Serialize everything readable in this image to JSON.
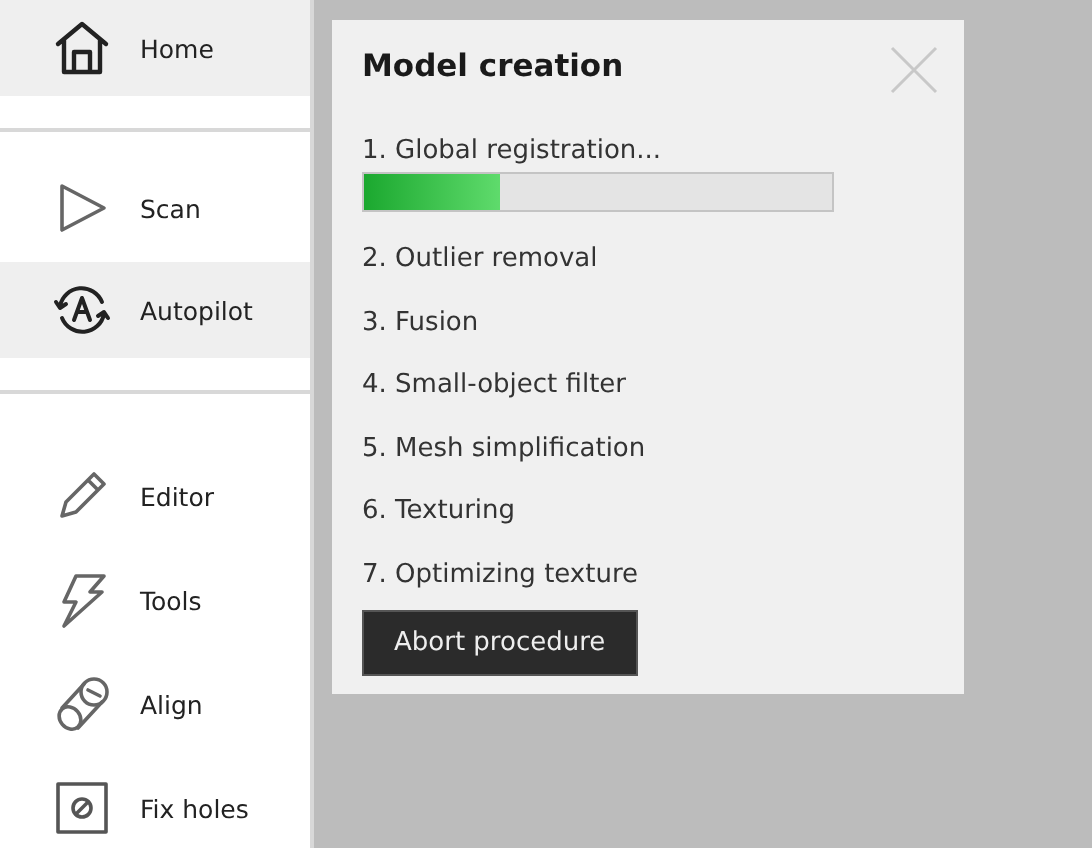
{
  "sidebar": {
    "groups": [
      {
        "items": [
          {
            "label": "Home",
            "highlighted": true
          }
        ]
      },
      {
        "items": [
          {
            "label": "Scan",
            "highlighted": false
          },
          {
            "label": "Autopilot",
            "highlighted": true
          }
        ]
      },
      {
        "items": [
          {
            "label": "Editor",
            "highlighted": false
          },
          {
            "label": "Tools",
            "highlighted": false
          },
          {
            "label": "Align",
            "highlighted": false
          },
          {
            "label": "Fix holes",
            "highlighted": false
          }
        ]
      }
    ]
  },
  "dialog": {
    "title": "Model creation",
    "steps": [
      {
        "label": "1. Global registration...",
        "level": 0.29
      },
      {
        "label": "2. Outlier removal"
      },
      {
        "label": "3. Fusion"
      },
      {
        "label": "4. Small-object filter"
      },
      {
        "label": "5. Mesh simplification"
      },
      {
        "label": "6. Texturing"
      },
      {
        "label": "7. Optimizing texture"
      }
    ],
    "button": "Abort procedure"
  }
}
